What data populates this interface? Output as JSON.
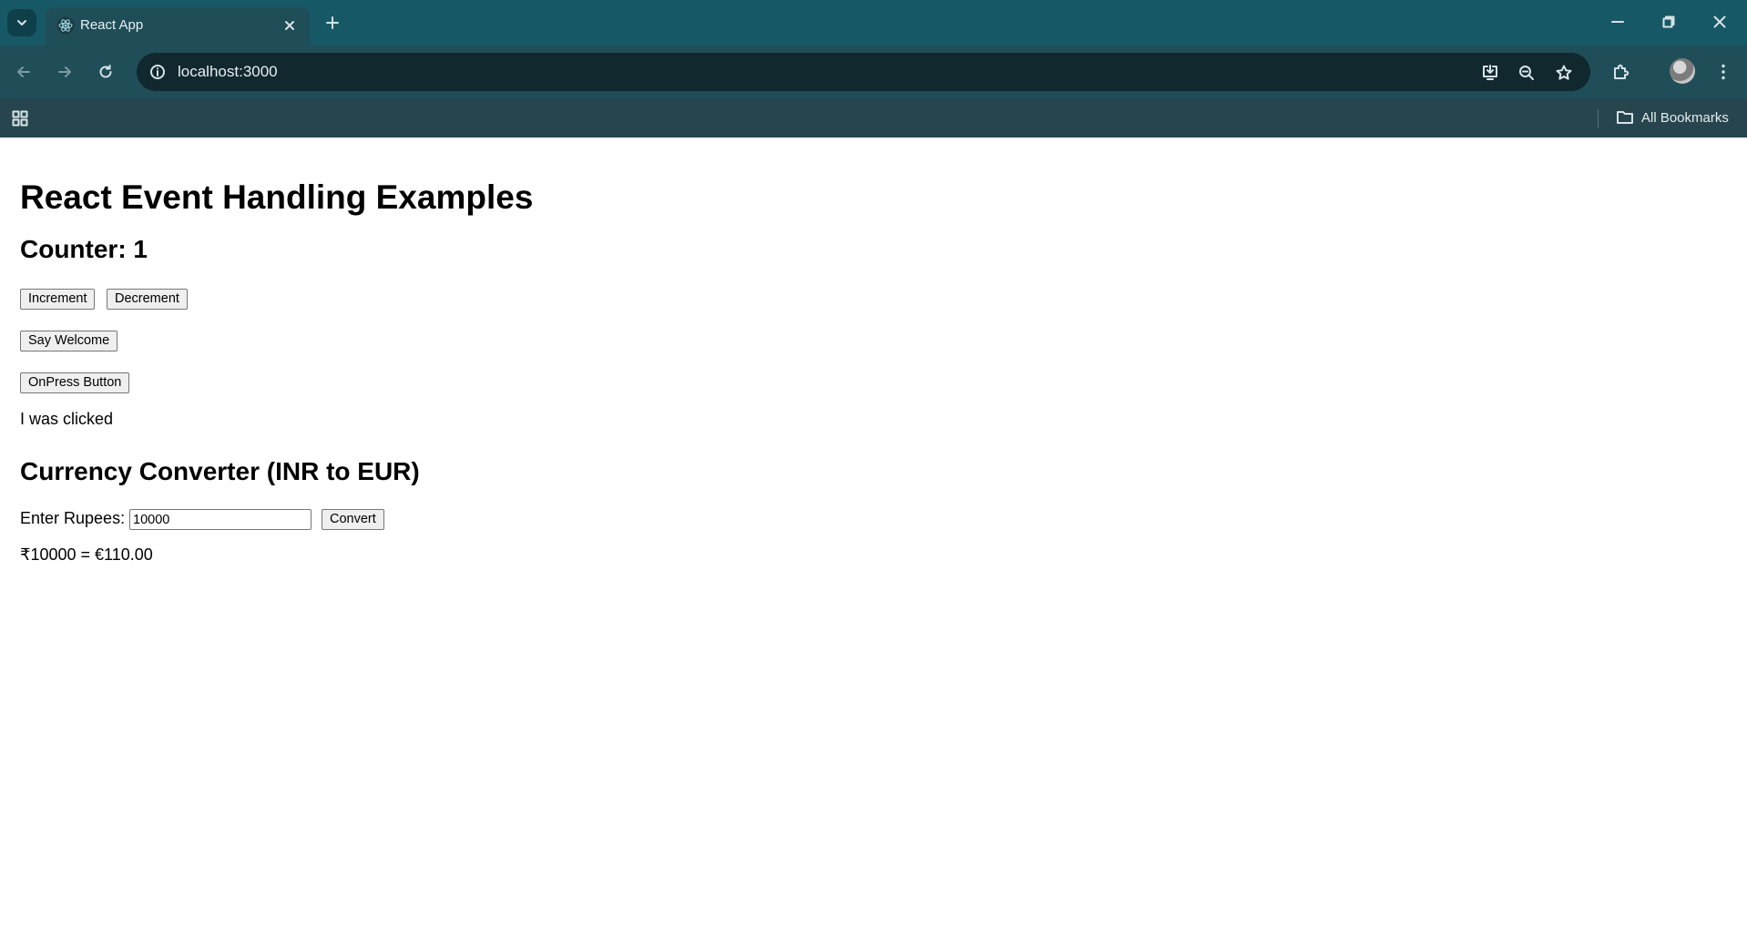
{
  "browser": {
    "tab_title": "React App",
    "url": "localhost:3000",
    "bookmarks_label": "All Bookmarks",
    "colors": {
      "tabstrip": "#175866",
      "toolbar": "#1f4d58",
      "omnibox": "#11282f",
      "bookmarks_bar": "#27454e"
    },
    "icons": {
      "tab_search": "chevron-down-icon",
      "favicon": "react-logo-icon",
      "tab_close": "close-icon",
      "new_tab": "plus-icon",
      "back": "arrow-left-icon",
      "forward": "arrow-right-icon",
      "reload": "reload-icon",
      "site_info": "info-icon",
      "install": "install-app-icon",
      "zoom": "zoom-out-icon",
      "bookmark": "star-icon",
      "extensions": "puzzle-icon",
      "menu": "kebab-menu-icon",
      "apps": "apps-grid-icon",
      "folder": "folder-icon"
    }
  },
  "page": {
    "title": "React Event Handling Examples",
    "counter_heading": "Counter: 1",
    "increment_label": "Increment",
    "decrement_label": "Decrement",
    "say_welcome_label": "Say Welcome",
    "onpress_label": "OnPress Button",
    "clicked_text": "I was clicked",
    "converter_heading": "Currency Converter (INR to EUR)",
    "rupees_label": "Enter Rupees:",
    "rupees_value": "10000",
    "convert_label": "Convert",
    "result_text": "₹10000 = €110.00"
  }
}
